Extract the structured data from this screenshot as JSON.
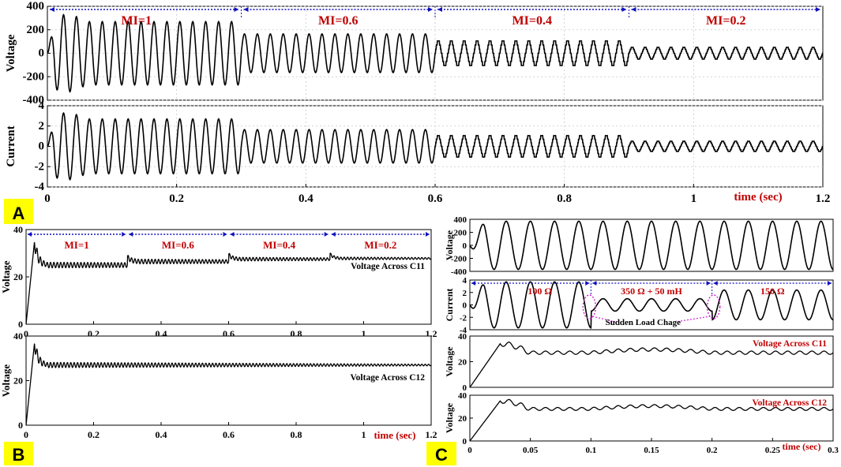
{
  "panels": {
    "A": "A",
    "B": "B",
    "C": "C"
  },
  "colors": {
    "trace": "#000000",
    "red_label": "#c00000",
    "blue_arrow": "#1010c0",
    "magenta": "#d020d0",
    "panel_label_bg": "#ffff00",
    "grid": "#c8c8c8"
  },
  "chart_data": [
    {
      "id": "A-voltage",
      "type": "line",
      "ylabel": "Voltage",
      "xlabel": "",
      "xlim": [
        0,
        1.2
      ],
      "ylim": [
        -400,
        400
      ],
      "yticks": [
        "-400",
        "-200",
        "0",
        "200",
        "400"
      ],
      "xticks": [],
      "grid": true,
      "segments": [
        {
          "label": "MI=1",
          "x": [
            0,
            0.3
          ],
          "amplitude": 270
        },
        {
          "label": "MI=0.6",
          "x": [
            0.3,
            0.6
          ],
          "amplitude": 165
        },
        {
          "label": "MI=0.4",
          "x": [
            0.6,
            0.9
          ],
          "amplitude": 105
        },
        {
          "label": "MI=0.2",
          "x": [
            0.9,
            1.2
          ],
          "amplitude": 50
        }
      ],
      "frequency_hz": 50,
      "startup_peak": 330
    },
    {
      "id": "A-current",
      "type": "line",
      "ylabel": "Current",
      "xlabel": "time (sec)",
      "xlim": [
        0,
        1.2
      ],
      "ylim": [
        -4,
        4
      ],
      "yticks": [
        "-4",
        "-2",
        "0",
        "2",
        "4"
      ],
      "xticks": [
        "0",
        "0.2",
        "0.4",
        "0.6",
        "0.8",
        "1",
        "1.2"
      ],
      "grid": true,
      "segments": [
        {
          "x": [
            0,
            0.3
          ],
          "amplitude": 2.7
        },
        {
          "x": [
            0.3,
            0.6
          ],
          "amplitude": 1.65
        },
        {
          "x": [
            0.6,
            0.9
          ],
          "amplitude": 1.05
        },
        {
          "x": [
            0.9,
            1.2
          ],
          "amplitude": 0.5
        }
      ],
      "frequency_hz": 50,
      "startup_peak": 3.3
    },
    {
      "id": "B-c11",
      "type": "line",
      "ylabel": "Voltage",
      "xlim": [
        0,
        1.2
      ],
      "ylim": [
        0,
        40
      ],
      "yticks": [
        "0",
        "20",
        "40"
      ],
      "xticks": [
        "0",
        "0.2",
        "0.4",
        "0.6",
        "0.8",
        "1",
        "1.2"
      ],
      "annotation": "Voltage Across C11",
      "segments": [
        {
          "label": "MI=1",
          "x": [
            0,
            0.3
          ],
          "level": 25
        },
        {
          "label": "MI=0.6",
          "x": [
            0.3,
            0.6
          ],
          "level": 26.5
        },
        {
          "label": "MI=0.4",
          "x": [
            0.6,
            0.9
          ],
          "level": 27.5
        },
        {
          "label": "MI=0.2",
          "x": [
            0.9,
            1.2
          ],
          "level": 27.8
        }
      ],
      "peak": 35
    },
    {
      "id": "B-c12",
      "type": "line",
      "ylabel": "Voltage",
      "xlabel": "time (sec)",
      "xlim": [
        0,
        1.2
      ],
      "ylim": [
        0,
        40
      ],
      "yticks": [
        "0",
        "20",
        "40"
      ],
      "xticks": [
        "0",
        "0.2",
        "0.4",
        "0.6",
        "0.8",
        "1",
        "1.2"
      ],
      "annotation": "Voltage Across C12",
      "level": 27,
      "peak": 37
    },
    {
      "id": "C-voltage",
      "type": "line",
      "ylabel": "Voltage",
      "xlim": [
        0,
        0.3
      ],
      "ylim": [
        -400,
        400
      ],
      "yticks": [
        "-400",
        "-200",
        "0",
        "200",
        "400"
      ],
      "amplitude": 370,
      "frequency_hz": 50
    },
    {
      "id": "C-current",
      "type": "line",
      "ylabel": "Current",
      "xlim": [
        0,
        0.3
      ],
      "ylim": [
        -4,
        4
      ],
      "yticks": [
        "-4",
        "-2",
        "0",
        "2",
        "4"
      ],
      "segments": [
        {
          "label": "100 Ω",
          "x": [
            0,
            0.1
          ],
          "amplitude": 3.7
        },
        {
          "label": "350 Ω + 50 mH",
          "x": [
            0.1,
            0.2
          ],
          "amplitude": 1.0
        },
        {
          "label": "150 Ω",
          "x": [
            0.2,
            0.3
          ],
          "amplitude": 2.4
        }
      ],
      "annotation": "Sudden Load Chage",
      "frequency_hz": 50
    },
    {
      "id": "C-c11",
      "type": "line",
      "ylabel": "Voltage",
      "xlim": [
        0,
        0.3
      ],
      "ylim": [
        0,
        40
      ],
      "yticks": [
        "0",
        "20",
        "40"
      ],
      "annotation": "Voltage Across C11",
      "peak": 34,
      "level": 27
    },
    {
      "id": "C-c12",
      "type": "line",
      "ylabel": "Voltage",
      "xlabel": "time (sec)",
      "xlim": [
        0,
        0.3
      ],
      "ylim": [
        0,
        40
      ],
      "yticks": [
        "0",
        "20",
        "40"
      ],
      "xticks": [
        "0",
        "0.05",
        "0.1",
        "0.15",
        "0.2",
        "0.25",
        "0.3"
      ],
      "annotation": "Voltage Across C12",
      "peak": 35,
      "level": 28
    }
  ]
}
